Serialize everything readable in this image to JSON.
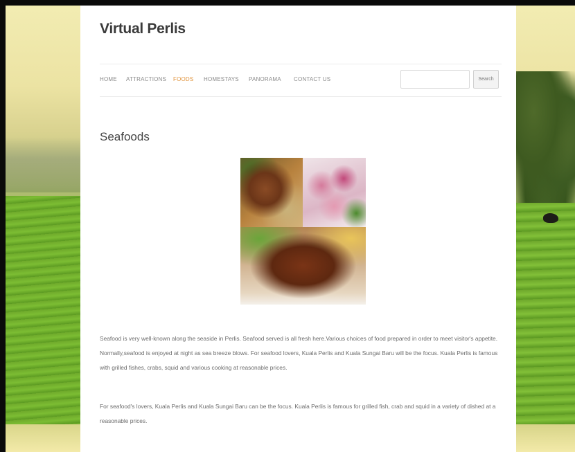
{
  "site": {
    "title": "Virtual Perlis"
  },
  "nav": {
    "items": [
      {
        "label": "HOME"
      },
      {
        "label": "ATTRACTIONS"
      },
      {
        "label": "FOODS"
      },
      {
        "label": "HOMESTAYS"
      },
      {
        "label": "PANORAMA"
      },
      {
        "label": "CONTACT US"
      }
    ],
    "active_index": 2,
    "active_color": "#e0923a"
  },
  "search": {
    "value": "",
    "button_label": "Search"
  },
  "content": {
    "heading": "Seafoods",
    "image_alt": "seafood-collage",
    "paragraphs": [
      "Seafood is very well-known along the seaside in Perlis. Seafood served is all fresh here.Various choices of food prepared in order to meet visitor's appetite. Normally,seafood is enjoyed at night as sea breeze blows. For seafood lovers, Kuala Perlis and Kuala Sungai Baru will be the focus. Kuala Perlis is famous with grilled fishes, crabs, squid and various cooking at reasonable prices.",
      "For seafood's lovers, Kuala Perlis and Kuala Sungai Baru can be the focus. Kuala Perlis is famous for grilled fish, crab and squid in a variety of dished at a reasonable prices."
    ]
  }
}
